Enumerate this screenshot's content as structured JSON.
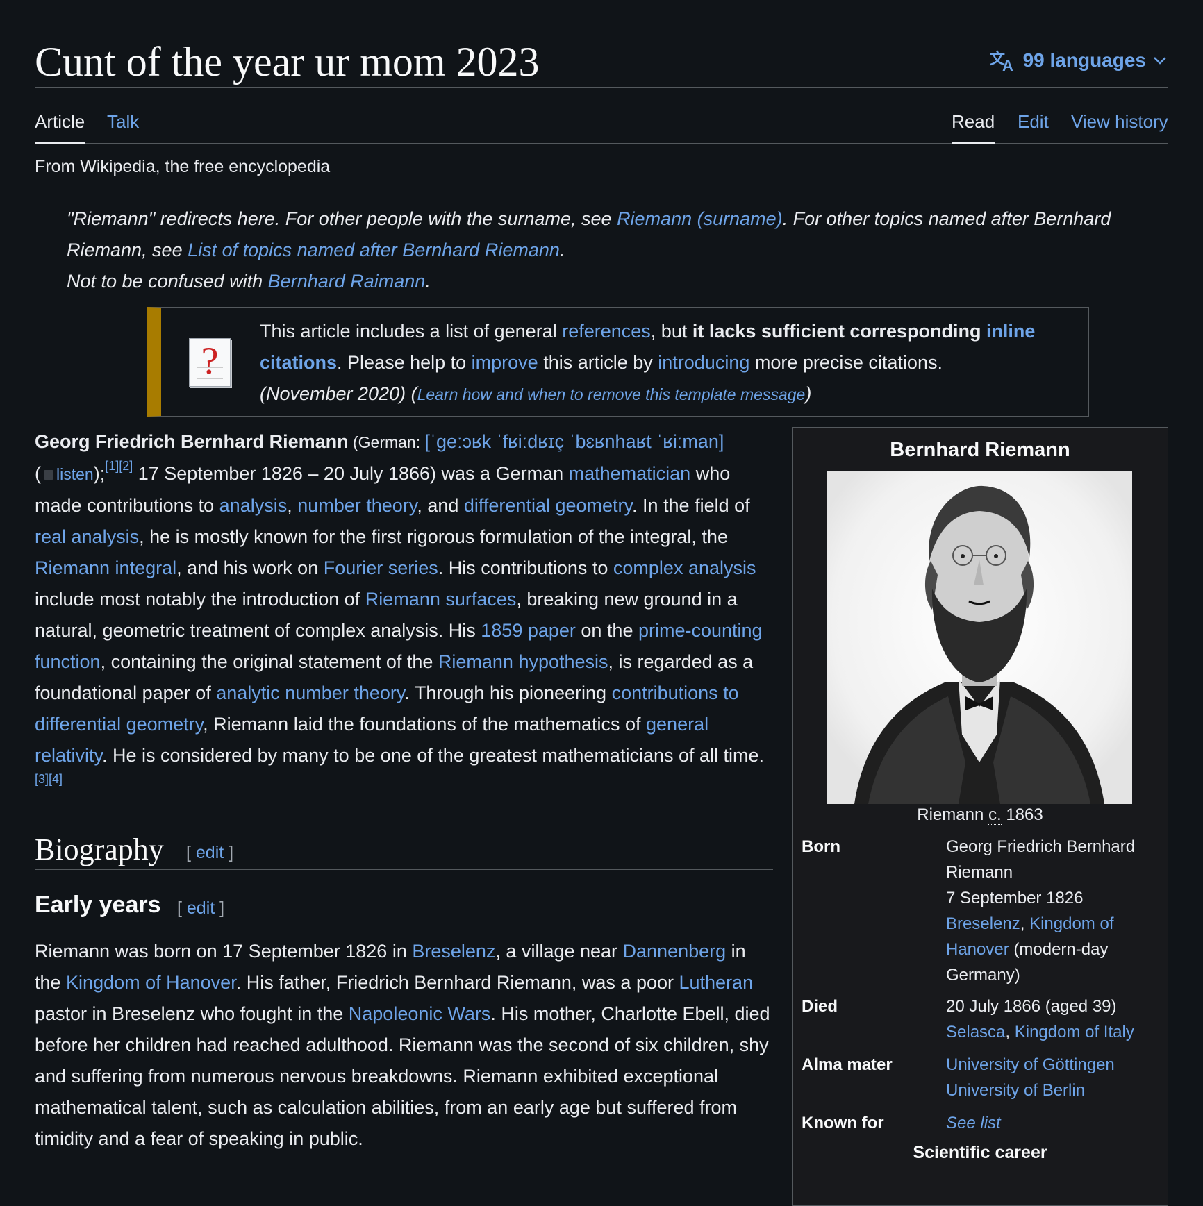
{
  "header": {
    "title": "Cunt of the year ur mom 2023",
    "languages_label": "99 languages"
  },
  "tabs": {
    "article": "Article",
    "talk": "Talk",
    "read": "Read",
    "edit": "Edit",
    "view_history": "View history"
  },
  "tagline": "From Wikipedia, the free encyclopedia",
  "hatnote": {
    "l1_pre": "\"Riemann\" redirects here. For other people with the surname, see ",
    "l1_link": "Riemann (surname)",
    "l1_mid": ". For other topics named after Bernhard Riemann, see ",
    "l1_link2": "List of topics named after Bernhard Riemann",
    "l1_end": ".",
    "l2_pre": "Not to be confused with ",
    "l2_link": "Bernhard Raimann",
    "l2_end": "."
  },
  "ambox": {
    "t1": "This article includes a list of general ",
    "link_references": "references",
    "t2": ", but ",
    "bold1": "it lacks sufficient corresponding ",
    "link_inline": "inline citations",
    "t3": ". Please help to ",
    "link_improve": "improve",
    "t4": " this article by ",
    "link_introducing": "introducing",
    "t5": " more precise citations.",
    "date": "(November 2020)",
    "paren_open": " (",
    "link_learn": "Learn how and when to remove this template message",
    "paren_close": ")"
  },
  "lead": {
    "name": "Georg Friedrich Bernhard Riemann",
    "german": " (German: ",
    "ipa": "[ˈɡeːɔʁk ˈfʁiːdʁɪç ˈbɛʁnhaʁt ˈʁiːman]",
    "listen_open": "(",
    "listen": "listen",
    "listen_close": ");",
    "ref1": "[1]",
    "ref2": "[2]",
    "s1": " 17 September 1826 – 20 July 1866) was a German ",
    "link_mathematician": "mathematician",
    "s2": " who made contributions to ",
    "link_analysis": "analysis",
    "s3": ", ",
    "link_number_theory": "number theory",
    "s4": ", and ",
    "link_diff_geo": "differential geometry",
    "s5": ". In the field of ",
    "link_real_analysis": "real analysis",
    "s6": ", he is mostly known for the first rigorous formulation of the integral, the ",
    "link_riemann_integral": "Riemann integral",
    "s7": ", and his work on ",
    "link_fourier": "Fourier series",
    "s8": ". His contributions to ",
    "link_complex_analysis": "complex analysis",
    "s9": " include most notably the introduction of ",
    "link_surfaces": "Riemann surfaces",
    "s10": ", breaking new ground in a natural, geometric treatment of complex analysis. His ",
    "link_1859": "1859 paper",
    "s11": " on the ",
    "link_prime_counting": "prime-counting function",
    "s12": ", containing the original statement of the ",
    "link_hypothesis": "Riemann hypothesis",
    "s13": ", is regarded as a foundational paper of ",
    "link_ant": "analytic number theory",
    "s14": ". Through his pioneering ",
    "link_contrib_dg": "contributions to differential geometry",
    "s15": ", Riemann laid the foundations of the mathematics of ",
    "link_gr": "general relativity",
    "s16": ". He is considered by many to be one of the greatest mathematicians of all time.",
    "ref3": "[3]",
    "ref4": "[4]"
  },
  "sections": {
    "biography": "Biography",
    "early_years": "Early years",
    "edit_open": "[ ",
    "edit": "edit",
    "edit_close": " ]"
  },
  "bio": {
    "b1": "Riemann was born on 17 September 1826 in ",
    "link_breselenz": "Breselenz",
    "b2": ", a village near ",
    "link_dannenberg": "Dannenberg",
    "b3": " in the ",
    "link_hanover": "Kingdom of Hanover",
    "b4": ". His father, Friedrich Bernhard Riemann, was a poor ",
    "link_lutheran": "Lutheran",
    "b5": " pastor in Breselenz who fought in the ",
    "link_napoleonic": "Napoleonic Wars",
    "b6": ". His mother, Charlotte Ebell, died before her children had reached adulthood. Riemann was the second of six children, shy and suffering from numerous nervous breakdowns. Riemann exhibited exceptional mathematical talent, such as calculation abilities, from an early age but suffered from timidity and a fear of speaking in public."
  },
  "infobox": {
    "title": "Bernhard Riemann",
    "caption_pre": "Riemann ",
    "caption_abbr": "c.",
    "caption_year": " 1863",
    "born_label": "Born",
    "born_name": "Georg Friedrich Bernhard Riemann",
    "born_date": "7 September 1826",
    "born_place_link1": "Breselenz",
    "born_sep": ", ",
    "born_place_link2": "Kingdom of Hanover",
    "born_modern": " (modern-day Germany)",
    "died_label": "Died",
    "died_date": "20 July 1866 (aged 39)",
    "died_place_link1": "Selasca",
    "died_sep": ", ",
    "died_place_link2": "Kingdom of Italy",
    "alma_label": "Alma mater",
    "alma_1": "University of Göttingen",
    "alma_2": "University of Berlin",
    "known_label": "Known for",
    "known_value": "See list",
    "career_header": "Scientific career"
  }
}
